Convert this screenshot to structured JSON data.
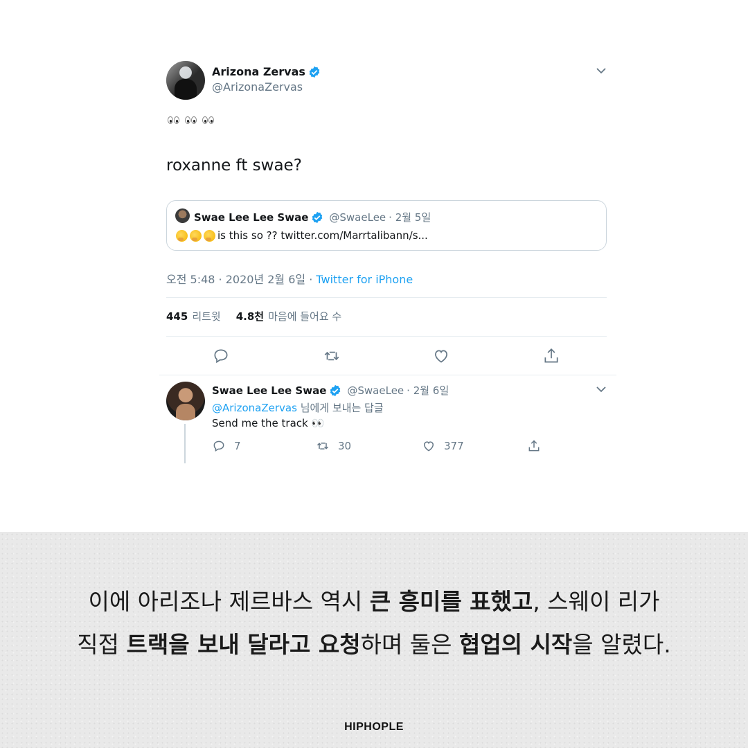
{
  "main_tweet": {
    "author_name": "Arizona Zervas",
    "author_handle": "@ArizonaZervas",
    "emoji_line": "👀👀👀",
    "text": "roxanne ft swae?",
    "quoted": {
      "author_name": "Swae Lee Lee Swae",
      "author_handle": "@SwaeLee",
      "date": "· 2월 5일",
      "text": "is this so ?? twitter.com/Marrtalibann/s..."
    },
    "timestamp": "오전 5:48 · 2020년 2월 6일 ·",
    "source": "Twitter for iPhone",
    "retweets_count": "445",
    "retweets_label": "리트윗",
    "likes_count": "4.8천",
    "likes_label": "마음에 들어요 수"
  },
  "reply_tweet": {
    "author_name": "Swae Lee Lee Swae",
    "author_handle": "@SwaeLee",
    "date": "· 2월 6일",
    "reply_to_mention": "@ArizonaZervas",
    "reply_to_suffix": "님에게 보내는 답글",
    "text": "Send me the track 👀",
    "replies": "7",
    "retweets": "30",
    "likes": "377"
  },
  "caption": {
    "line1": [
      {
        "text": "이에 아리조나 제르바스 역시 ",
        "bold": false
      },
      {
        "text": "큰 흥미를 표했고",
        "bold": true
      },
      {
        "text": ", 스웨이 리가",
        "bold": false
      }
    ],
    "line2": [
      {
        "text": "직접 ",
        "bold": false
      },
      {
        "text": "트랙을 보내 달라고 요청",
        "bold": true
      },
      {
        "text": "하며 둘은 ",
        "bold": false
      },
      {
        "text": "협업의 시작",
        "bold": true
      },
      {
        "text": "을 알렸다.",
        "bold": false
      }
    ]
  },
  "brand": "HIPHOPLE",
  "colors": {
    "accent": "#1da1f2",
    "muted": "#657786",
    "border": "#ccd6dd",
    "caption_bg": "#e9e9e9"
  },
  "icons": [
    "chevron-down-icon",
    "verified-badge-icon",
    "reply-icon",
    "retweet-icon",
    "like-icon",
    "share-icon",
    "eyes-emoji-icon",
    "thinking-emoji-icon"
  ]
}
